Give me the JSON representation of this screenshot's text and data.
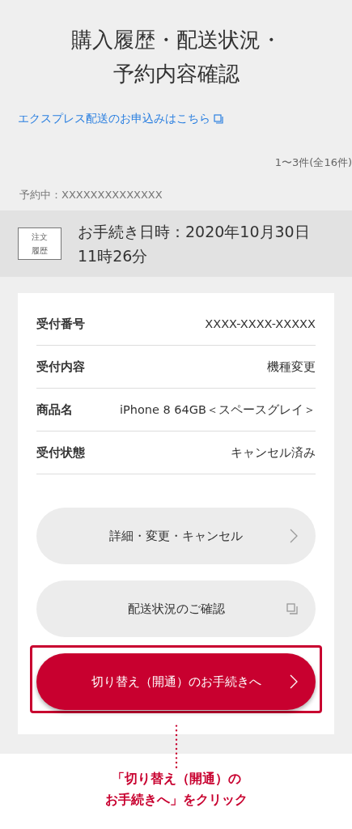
{
  "title": "購入履歴・配送状況・予約内容確認",
  "express_link": "エクスプレス配送のお申込みはこちら",
  "count": "1〜3件(全16件)",
  "reservation": "予約中：XXXXXXXXXXXXXX",
  "order": {
    "badge": "注文履歴",
    "datetime": "お手続き日時：2020年10月30日11時26分"
  },
  "details": [
    {
      "label": "受付番号",
      "value": "XXXX-XXXX-XXXXX"
    },
    {
      "label": "受付内容",
      "value": "機種変更"
    },
    {
      "label": "商品名",
      "value": "iPhone 8 64GB＜スペースグレイ＞"
    },
    {
      "label": "受付状態",
      "value": "キャンセル済み"
    }
  ],
  "buttons": [
    {
      "label": "詳細・変更・キャンセル",
      "kind": "chevron",
      "primary": false,
      "highlighted": false
    },
    {
      "label": "配送状況のご確認",
      "kind": "external",
      "primary": false,
      "highlighted": false
    },
    {
      "label": "切り替え（開通）のお手続きへ",
      "kind": "chevron",
      "primary": true,
      "highlighted": true
    }
  ],
  "annotation": [
    "「切り替え（開通）の",
    "お手続きへ」をクリック"
  ]
}
